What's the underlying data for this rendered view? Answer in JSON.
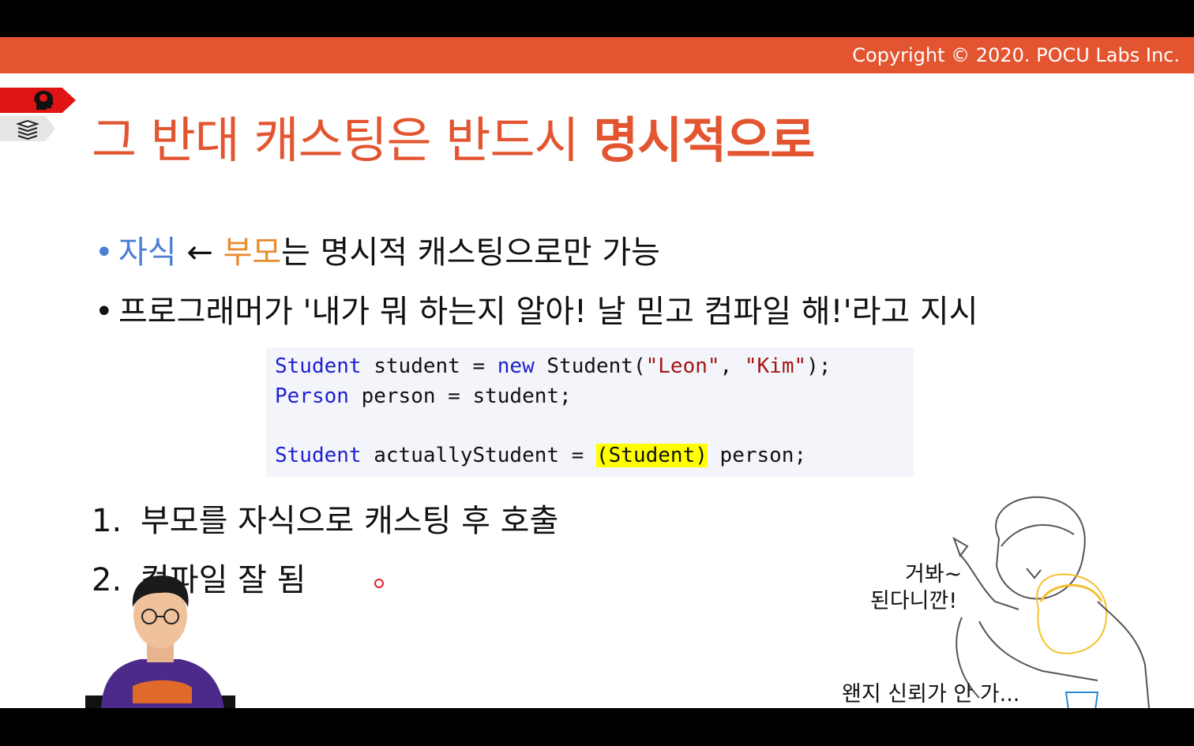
{
  "header": {
    "copyright": "Copyright © 2020. POCU Labs Inc."
  },
  "title": {
    "part1": "그 반대 캐스팅은 반드시 ",
    "part2_bold": "명시적으로"
  },
  "bullets": [
    {
      "dot": "•",
      "child": "자식",
      "arrow": " ← ",
      "parent": "부모",
      "rest": "는 명시적 캐스팅으로만 가능"
    },
    {
      "dot": "•",
      "text": "프로그래머가 '내가 뭐 하는지 알아! 날 믿고 컴파일 해!'라고 지시"
    }
  ],
  "code": {
    "line1": {
      "type": "Student",
      "a": " student = ",
      "kw_new": "new",
      "b": " Student(",
      "s1": "\"Leon\"",
      "c": ", ",
      "s2": "\"Kim\"",
      "d": ");"
    },
    "line2": {
      "type": "Person",
      "a": " person = student;"
    },
    "line3": {
      "type": "Student",
      "a": " actuallyStudent = ",
      "cast": "(Student)",
      "b": " person;"
    }
  },
  "steps": [
    {
      "index": "1.",
      "text": "부모를 자식으로 캐스팅 후 호출"
    },
    {
      "index": "2.",
      "text": "컴파일 잘 됨"
    }
  ],
  "cartoon": {
    "speech1_line1": "거봐~",
    "speech1_line2": "된다니깐!",
    "speech2": "왠지 신뢰가 안 가..."
  },
  "colors": {
    "accent": "#e35530",
    "child": "#4a7fd4",
    "parent": "#e88b2e",
    "keyword": "#1f1fd1",
    "string": "#a31515",
    "highlight": "#ffff00"
  },
  "icons": {
    "corner_top": "brain-head-icon",
    "corner_bottom": "book-stack-icon"
  }
}
